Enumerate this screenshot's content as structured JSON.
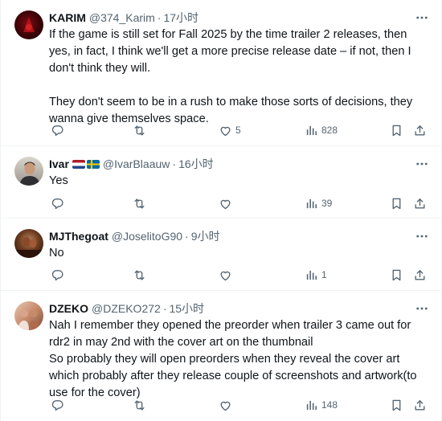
{
  "tweets": [
    {
      "name": "KARIM",
      "handle": "@374_Karim",
      "dot": "·",
      "time": "17小时",
      "text": [
        "If the game is still set for Fall 2025 by the time trailer 2 releases, then yes, in fact, I think we'll get a more precise release date – if not, then I don't think they will.",
        "They don't seem to be in a rush to make those sorts of decisions, they wanna give themselves space."
      ],
      "replies": "",
      "retweets": "",
      "likes": "5",
      "views": "828"
    },
    {
      "name": "Ivar",
      "handle": "@IvarBlaauw",
      "dot": "·",
      "time": "16小时",
      "flags": [
        "netherlands-flag",
        "sweden-flag"
      ],
      "text": [
        "Yes"
      ],
      "replies": "",
      "retweets": "",
      "likes": "",
      "views": "39"
    },
    {
      "name": "MJThegoat",
      "handle": "@JoselitoG90",
      "dot": "·",
      "time": "9小时",
      "text": [
        "No"
      ],
      "replies": "",
      "retweets": "",
      "likes": "",
      "views": "1"
    },
    {
      "name": "DZEKO",
      "handle": "@DZEKO272",
      "dot": "·",
      "time": "15小时",
      "text": [
        "Nah I remember they opened the preorder when trailer 3 came out for rdr2 in may 2nd with the cover art on the thumbnail",
        "So probably they will open preorders when they reveal the cover art which probably after they release couple of screenshots and artwork(to use for the cover)"
      ],
      "replies": "",
      "retweets": "",
      "likes": "",
      "views": "148"
    }
  ],
  "icons": {
    "more": "more-horizontal-icon",
    "reply": "reply-bubble-icon",
    "retweet": "retweet-icon",
    "like": "heart-icon",
    "views": "views-bar-chart-icon",
    "bookmark": "bookmark-icon",
    "share": "share-upload-icon"
  },
  "colors": {
    "text": "#0f1419",
    "secondary": "#536471",
    "divider": "#eff3f4"
  }
}
